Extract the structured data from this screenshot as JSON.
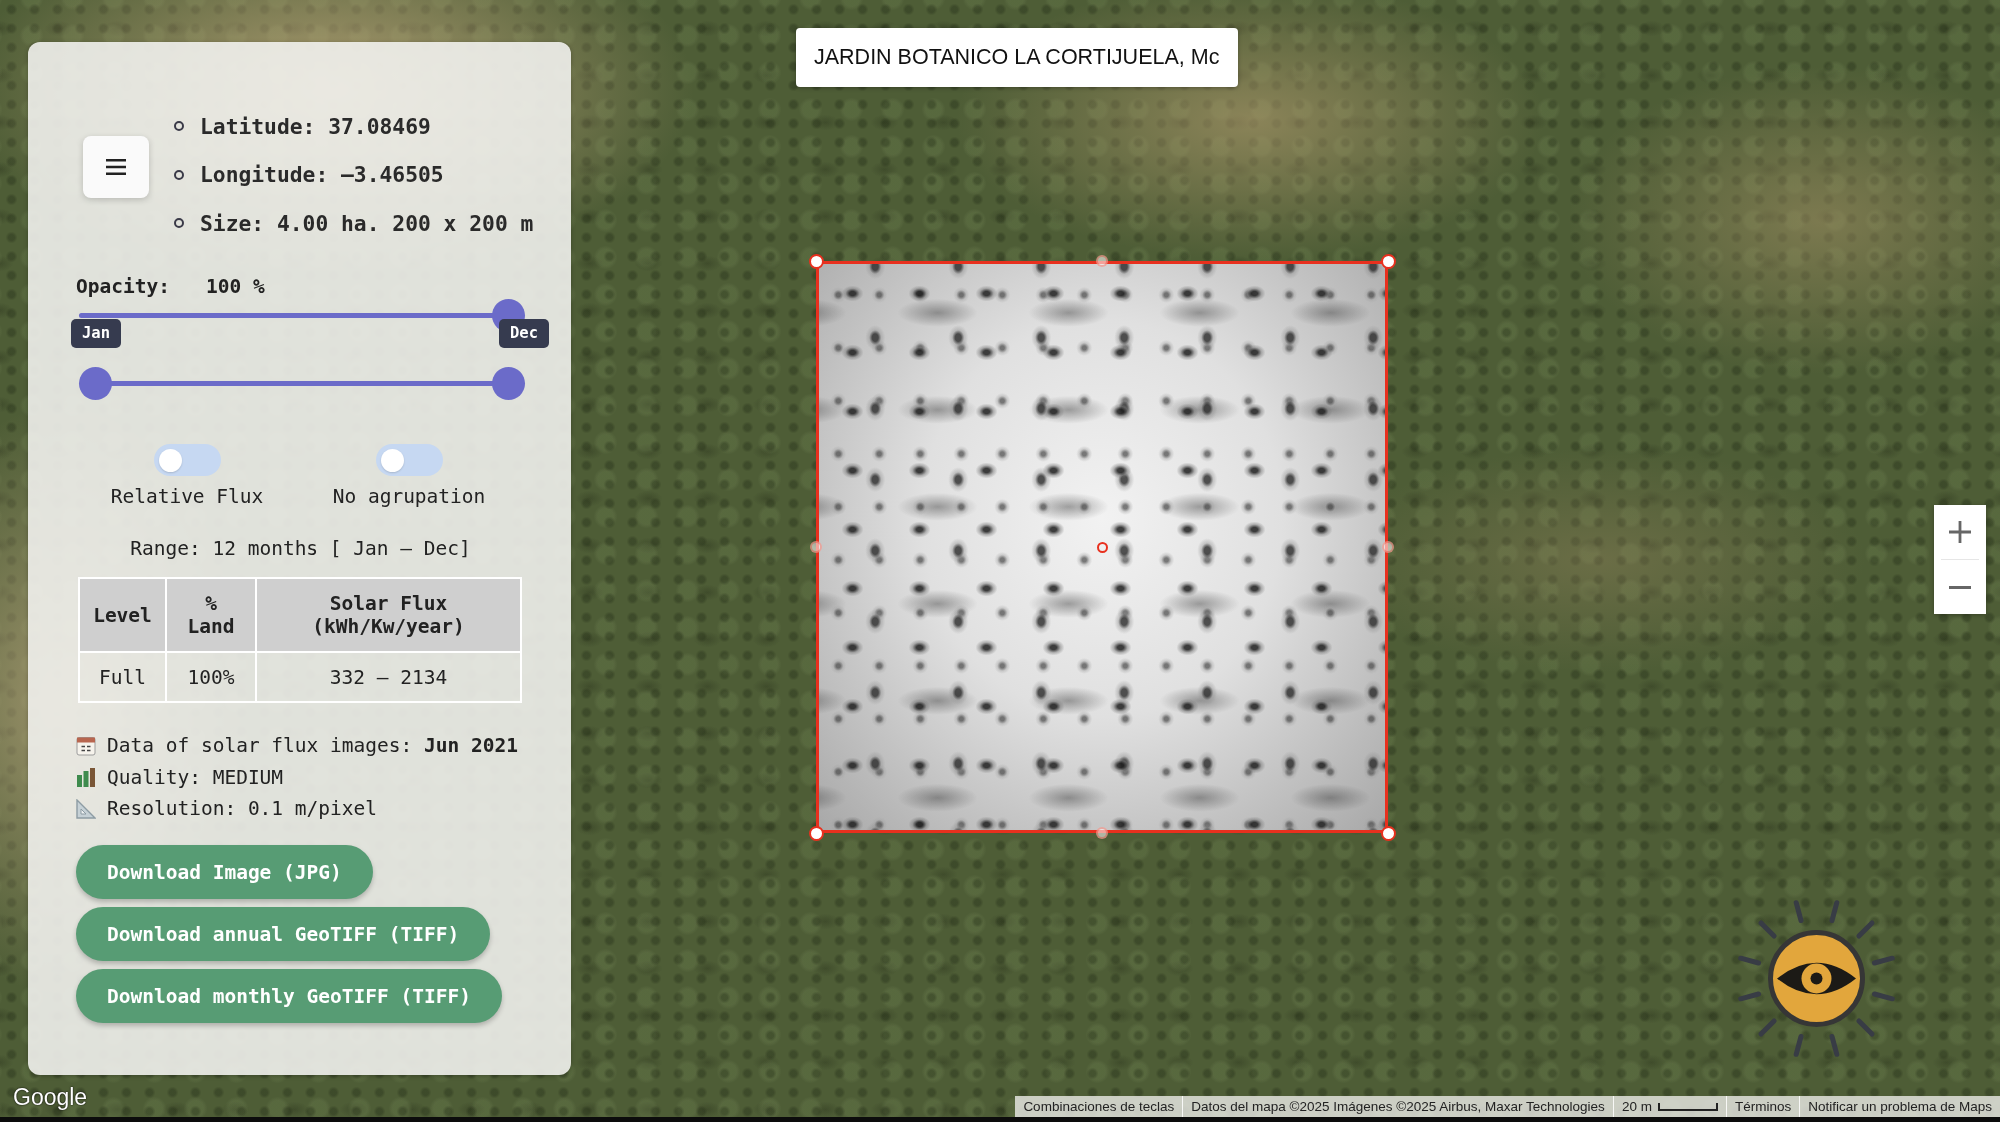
{
  "search": {
    "value": "JARDIN BOTANICO LA CORTIJUELA, Mc"
  },
  "panel": {
    "info": [
      "Latitude: 37.08469",
      "Longitude: –3.46505",
      "Size: 4.00 ha. 200 x 200 m"
    ],
    "opacity": {
      "label": "Opacity:",
      "reading": "100 %",
      "level": 1
    },
    "month_range": {
      "thumbs": [
        {
          "label": "Jan",
          "level": 0
        },
        {
          "label": "Dec",
          "level": 1
        }
      ]
    },
    "toggles": [
      {
        "label": "Relative Flux",
        "on": false
      },
      {
        "label": "No agrupation",
        "on": false
      }
    ],
    "range_text": "Range: 12 months [ Jan – Dec]",
    "table": {
      "columns": [
        "Level",
        "% Land",
        "Solar Flux (kWh/Kw/year)"
      ],
      "rows": [
        [
          "Full",
          "100%",
          "332 – 2134"
        ]
      ]
    },
    "details": [
      {
        "kind": "calendar",
        "text": "Data of solar flux images: **Jun 2021**"
      },
      {
        "kind": "chart",
        "text": "Quality: MEDIUM"
      },
      {
        "kind": "ruler",
        "text": "Resolution: 0.1 m/pixel"
      }
    ],
    "buttons": [
      "Download Image (JPG)",
      "Download annual GeoTIFF (TIFF)",
      "Download monthly GeoTIFF (TIFF)"
    ]
  },
  "map": {
    "logo": "Google",
    "footer": [
      {
        "kind": "link",
        "text": "Combinaciones de teclas"
      },
      {
        "kind": "credit",
        "text": "Datos del mapa ©2025 Imágenes ©2025 Airbus, Maxar Technologies"
      },
      {
        "kind": "scale",
        "text": "20 m"
      },
      {
        "kind": "link",
        "text": "Términos"
      },
      {
        "kind": "link",
        "text": "Notificar un problema de Maps"
      }
    ]
  }
}
